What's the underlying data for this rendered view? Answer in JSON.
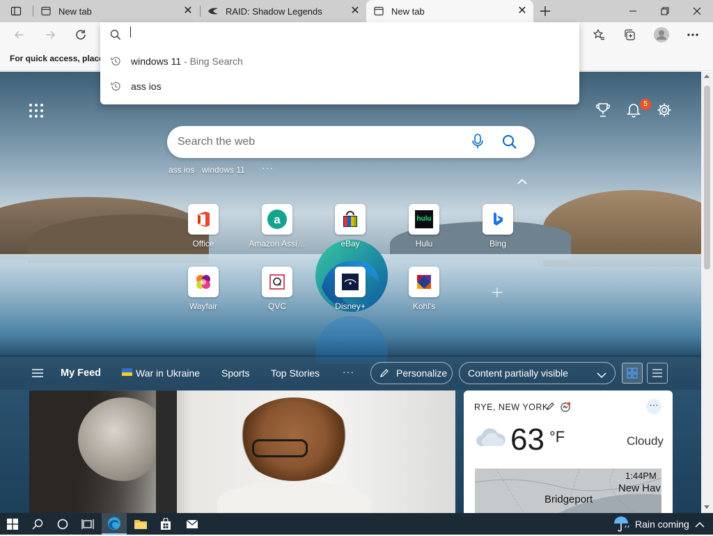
{
  "tabs": [
    {
      "label": "New tab",
      "icon": "newtab-icon"
    },
    {
      "label": "RAID: Shadow Legends",
      "icon": "raid-icon"
    },
    {
      "label": "New tab",
      "icon": "newtab-icon",
      "active": true
    }
  ],
  "favbar": {
    "text": "For quick access, place y"
  },
  "omnibox": {
    "value": "",
    "suggestions": [
      {
        "text": "windows 11",
        "suffix": " - Bing Search"
      },
      {
        "text": "ass ios",
        "suffix": ""
      }
    ]
  },
  "ntp": {
    "notification_count": "5",
    "search_placeholder": "Search the web",
    "recent_searches": [
      "ass ios",
      "windows 11"
    ],
    "more_label": "···",
    "quick_links_row1": [
      "Office",
      "Amazon Assi…",
      "eBay",
      "Hulu",
      "Bing"
    ],
    "quick_links_row2": [
      "Wayfair",
      "QVC",
      "Disney+",
      "Kohl's"
    ],
    "hulu_logo_text": "hulu"
  },
  "feed": {
    "my_feed": "My Feed",
    "tabs": [
      "War in Ukraine",
      "Sports",
      "Top Stories"
    ],
    "more": "···",
    "personalize": "Personalize",
    "content_visibility": "Content partially visible"
  },
  "weather": {
    "location": "RYE, NEW YORK",
    "temperature": "63",
    "unit": "°F",
    "condition": "Cloudy",
    "more": "···",
    "map_time": "1:44PM",
    "map_city1": "Bridgeport",
    "map_city2": "New Hav"
  },
  "taskbar": {
    "weather_text": "Rain coming"
  },
  "colors": {
    "accent": "#0067c0",
    "badge": "#e8552a",
    "taskbar": "#1c2a36"
  }
}
